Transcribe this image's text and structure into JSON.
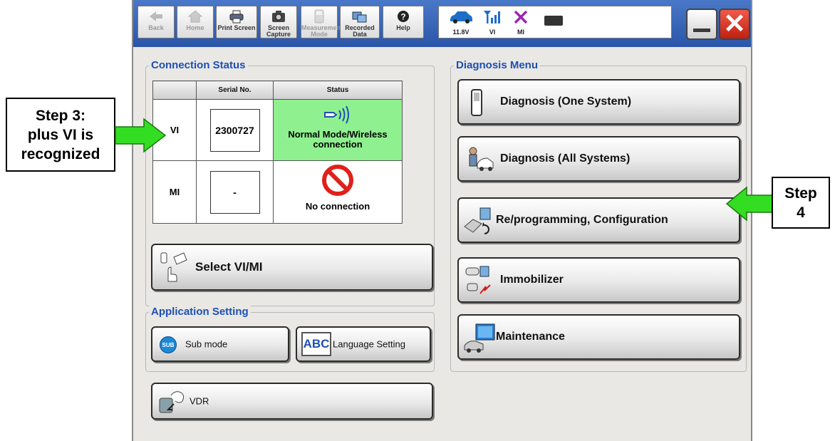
{
  "toolbar": {
    "back": "Back",
    "home": "Home",
    "print_screen": "Print Screen",
    "screen_capture_1": "Screen",
    "screen_capture_2": "Capture",
    "measurement_1": "Measurement",
    "measurement_2": "Mode",
    "recorded_1": "Recorded",
    "recorded_2": "Data",
    "help": "Help"
  },
  "status_bar": {
    "voltage": "11.8V",
    "vi": "VI",
    "mi": "MI"
  },
  "connection_status": {
    "title": "Connection Status",
    "col_serial": "Serial No.",
    "col_status": "Status",
    "rows": [
      {
        "device": "VI",
        "serial": "2300727",
        "status": "Normal Mode/Wireless connection"
      },
      {
        "device": "MI",
        "serial": "-",
        "status": "No connection"
      }
    ],
    "select_button": "Select VI/MI"
  },
  "application_setting": {
    "title": "Application Setting",
    "sub_mode": "Sub mode",
    "sub_icon": "SUB",
    "language": "Language Setting",
    "language_icon": "ABC"
  },
  "vdr": "VDR",
  "diagnosis_menu": {
    "title": "Diagnosis Menu",
    "items": [
      "Diagnosis (One System)",
      "Diagnosis (All Systems)",
      "Re/programming, Configuration",
      "Immobilizer",
      "Maintenance"
    ]
  },
  "callouts": {
    "step3_1": "Step 3:",
    "step3_2": "plus VI is",
    "step3_3": "recognized",
    "step4_1": "Step",
    "step4_2": "4"
  },
  "colors": {
    "accent_title": "#1d4fb6",
    "connected_green": "#8ff08f",
    "arrow_green": "#33dd22",
    "toolbar_blue": "#2a55a8"
  }
}
